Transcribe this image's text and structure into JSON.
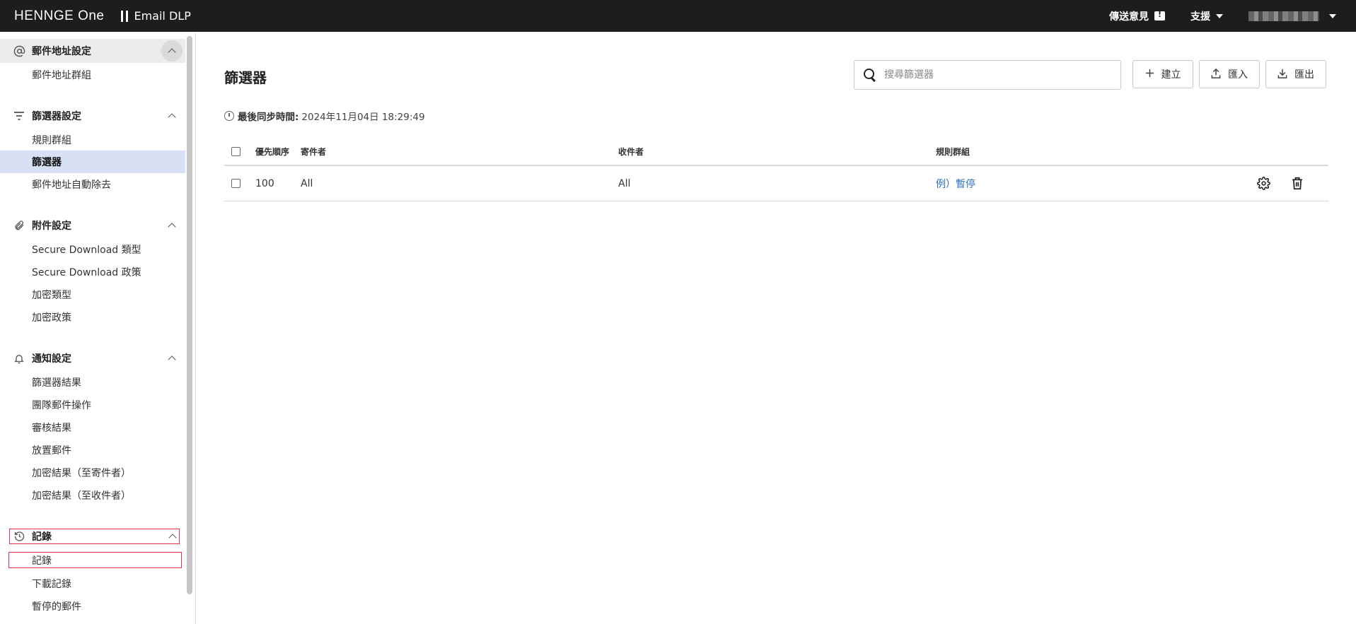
{
  "topbar": {
    "brand": "HENNGE One",
    "product": "Email DLP",
    "feedback": "傳送意見",
    "support": "支援"
  },
  "sidebar": {
    "sections": [
      {
        "title": "郵件地址設定",
        "icon": "at-icon",
        "items": [
          "郵件地址群組"
        ]
      },
      {
        "title": "篩選器設定",
        "icon": "filter-icon",
        "items": [
          "規則群組",
          "篩選器",
          "郵件地址自動除去"
        ]
      },
      {
        "title": "附件設定",
        "icon": "paperclip-icon",
        "items": [
          "Secure Download 類型",
          "Secure Download 政策",
          "加密類型",
          "加密政策"
        ]
      },
      {
        "title": "通知設定",
        "icon": "bell-icon",
        "items": [
          "篩選器結果",
          "團隊郵件操作",
          "審核結果",
          "放置郵件",
          "加密結果（至寄件者）",
          "加密結果（至收件者）"
        ]
      },
      {
        "title": "記錄",
        "icon": "history-icon",
        "items": [
          "記錄",
          "下載記錄",
          "暫停的郵件"
        ]
      }
    ]
  },
  "main": {
    "title": "篩選器",
    "search_placeholder": "搜尋篩選器",
    "buttons": {
      "create": "建立",
      "import": "匯入",
      "export": "匯出"
    },
    "sync_label": "最後同步時間:",
    "sync_time": "2024年11月04日 18:29:49",
    "columns": {
      "priority": "優先順序",
      "sender": "寄件者",
      "recipient": "收件者",
      "rule_group": "規則群組"
    },
    "rows": [
      {
        "priority": "100",
        "sender": "All",
        "recipient": "All",
        "rule_group": "例）暫停"
      }
    ]
  },
  "colors": {
    "topbar": "#1d1d1f",
    "active_item": "#d7e1f3",
    "link": "#2f6fb5",
    "highlight_outline": "#d9344a"
  }
}
